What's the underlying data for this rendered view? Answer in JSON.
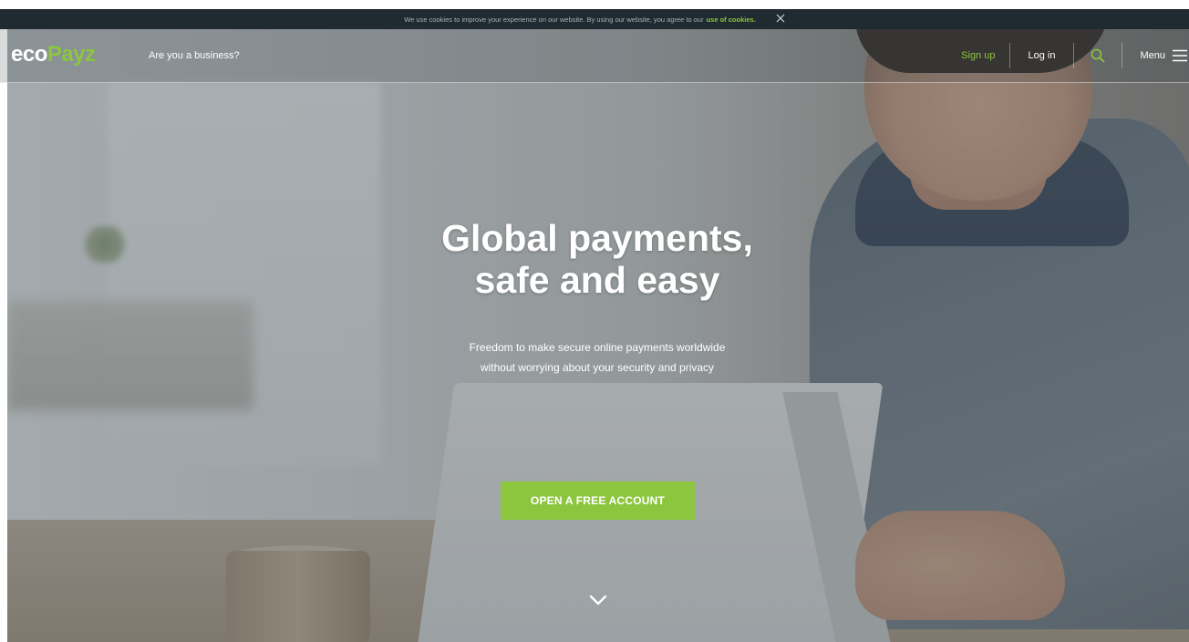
{
  "cookie_bar": {
    "text": "We use cookies to improve your experience on our website. By using our website, you agree to our",
    "link": "use of cookies.",
    "close_icon": "close-icon"
  },
  "header": {
    "logo": {
      "eco": "eco",
      "payz": "Payz"
    },
    "business_link": "Are you a business?",
    "sign_up": "Sign up",
    "log_in": "Log in",
    "search_icon": "search-icon",
    "menu_label": "Menu",
    "menu_icon": "hamburger-icon"
  },
  "hero": {
    "title_line1": "Global payments,",
    "title_line2": "safe and easy",
    "subtitle_line1": "Freedom to make secure online payments worldwide",
    "subtitle_line2": "without worrying about your security and privacy",
    "cta_label": "OPEN A FREE ACCOUNT",
    "scroll_icon": "chevron-down-icon"
  },
  "colors": {
    "brand_green": "#8cc63f",
    "cookie_bar_bg": "#1f2b30",
    "text_white": "#ffffff"
  }
}
